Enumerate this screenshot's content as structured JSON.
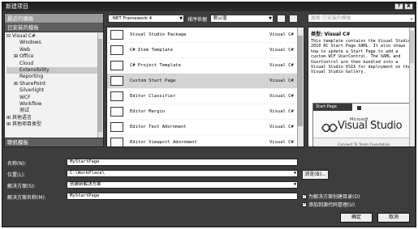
{
  "window": {
    "title": "新建项目",
    "help_btn": "?",
    "close_btn": "X"
  },
  "left": {
    "recent": "最近的模板",
    "installed": "已安装的模板",
    "online": "联机模板",
    "tree": [
      {
        "toggle": "⊟",
        "label": "Visual C#",
        "indent": 0
      },
      {
        "toggle": "",
        "label": "Windows",
        "indent": 1
      },
      {
        "toggle": "",
        "label": "Web",
        "indent": 1
      },
      {
        "toggle": "⊞",
        "label": "Office",
        "indent": 1
      },
      {
        "toggle": "",
        "label": "Cloud",
        "indent": 1
      },
      {
        "toggle": "",
        "label": "Extensibility",
        "indent": 1,
        "selected": true
      },
      {
        "toggle": "",
        "label": "Reporting",
        "indent": 1
      },
      {
        "toggle": "⊞",
        "label": "SharePoint",
        "indent": 1
      },
      {
        "toggle": "",
        "label": "Silverlight",
        "indent": 1
      },
      {
        "toggle": "",
        "label": "WCF",
        "indent": 1
      },
      {
        "toggle": "",
        "label": "Workflow",
        "indent": 1
      },
      {
        "toggle": "",
        "label": "测试",
        "indent": 1
      },
      {
        "toggle": "⊞",
        "label": "其他语言",
        "indent": 0
      },
      {
        "toggle": "⊞",
        "label": "其他项目类型",
        "indent": 0
      }
    ]
  },
  "toolbar": {
    "framework": ".NET Framework 4",
    "sort_label": "排序依据",
    "sort_value": "默认值"
  },
  "search": {
    "placeholder": "搜索 已安装的模板"
  },
  "templates": [
    {
      "name": "Visual Studio Package",
      "lang": "Visual C#"
    },
    {
      "name": "C# Item Template",
      "lang": "Visual C#"
    },
    {
      "name": "C# Project Template",
      "lang": "Visual C#"
    },
    {
      "name": "Custom Start Page",
      "lang": "Visual C#",
      "selected": true
    },
    {
      "name": "Editor Classifier",
      "lang": "Visual C#"
    },
    {
      "name": "Editor Margin",
      "lang": "Visual C#"
    },
    {
      "name": "Editor Text Adornment",
      "lang": "Visual C#"
    },
    {
      "name": "Editor Viewport Adornment",
      "lang": "Visual C#"
    }
  ],
  "description": {
    "type": "类型: Visual C#",
    "text": "This template contains the Visual Studio 2010 RC Start Page XAML. It also shows how to update a Start Page to add a custom WCF UserControl. The XAML and UserControl are then bundled into a Visual Studio VSIX for deployment on the Visual Studio Gallery.",
    "preview": {
      "tab": "Start Page",
      "microsoft": "Microsoft",
      "brand": "Visual Studio",
      "bottom": "Connect To Team Foundation"
    }
  },
  "form": {
    "name_label": "名称(N):",
    "name_value": "MyStartPage",
    "location_label": "位置(L):",
    "location_value": "C:\\WorkPlace\\",
    "solution_label": "解决方案(S):",
    "solution_value": "创建新解决方案",
    "solution_name_label": "解决方案名称(M):",
    "solution_name_value": "MyStartPage",
    "browse": "浏览(B)...",
    "create_dir": "为解决方案创建目录(D)",
    "add_source": "添加到源代码管理(U)"
  },
  "buttons": {
    "ok": "确定",
    "cancel": "取消"
  }
}
